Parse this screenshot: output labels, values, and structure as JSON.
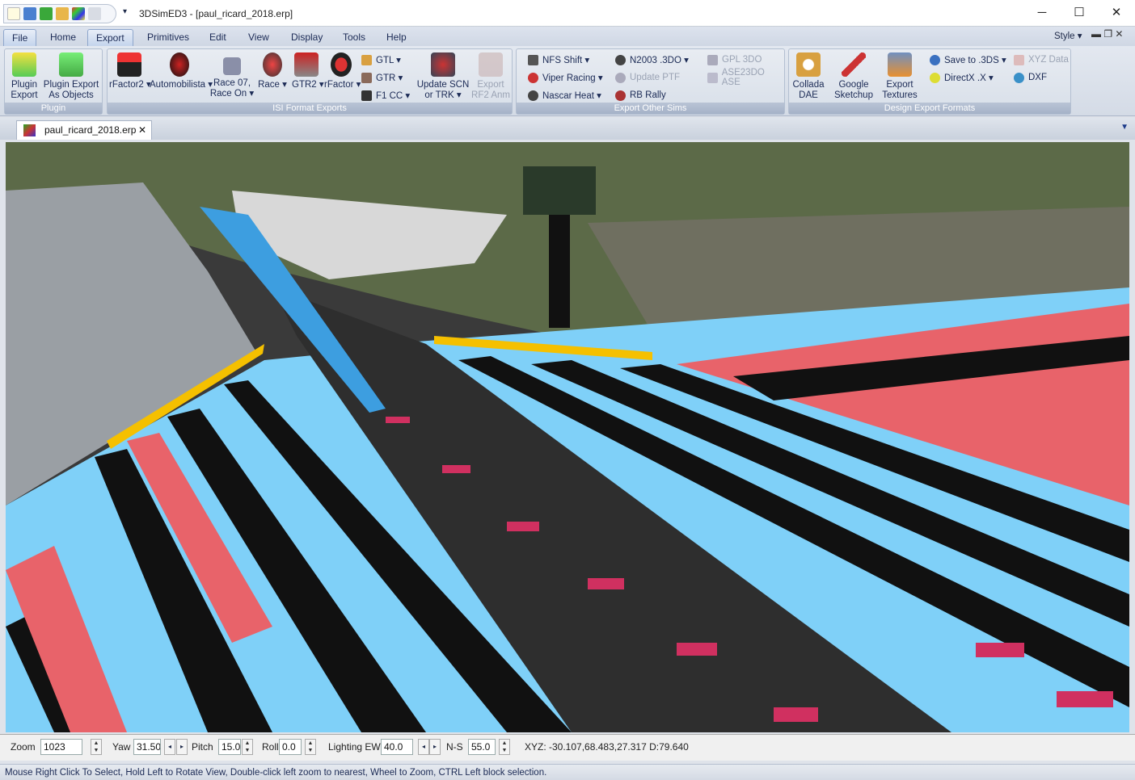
{
  "window": {
    "title": "3DSimED3 - [paul_ricard_2018.erp]",
    "minimize": "─",
    "maximize": "☐",
    "close": "✕"
  },
  "menu": {
    "tabs": [
      "File",
      "Home",
      "Export",
      "Primitives",
      "Edit",
      "View",
      "Display",
      "Tools",
      "Help"
    ],
    "active": "Export",
    "style": "Style ▾"
  },
  "ribbon": {
    "plugin": {
      "label": "Plugin",
      "buttons": [
        "Plugin\nExport",
        "Plugin Export\nAs Objects"
      ]
    },
    "isi": {
      "label": "ISI Format Exports",
      "buttons": [
        "rFactor2 ▾",
        "Automobilista ▾",
        "Race 07,\nRace On ▾",
        "Race ▾",
        "GTR2 ▾",
        "rFactor ▾"
      ],
      "small": [
        "GTL ▾",
        "GTR ▾",
        "F1 CC ▾"
      ],
      "buttons2": [
        "Update SCN\nor TRK ▾",
        "Export\nRF2 Anm"
      ]
    },
    "other": {
      "label": "Export Other Sims",
      "col1": [
        "NFS Shift ▾",
        "Viper Racing ▾",
        "Nascar Heat ▾"
      ],
      "col2": [
        "N2003 .3DO ▾",
        "Update PTF",
        "RB Rally"
      ],
      "col3": [
        "GPL 3DO",
        "ASE23DO ASE"
      ]
    },
    "design": {
      "label": "Design Export Formats",
      "buttons": [
        "Collada\nDAE",
        "Google\nSketchup",
        "Export\nTextures"
      ],
      "col1": [
        "Save to .3DS ▾",
        "DirectX .X ▾"
      ],
      "col2": [
        "XYZ Data",
        "DXF"
      ]
    }
  },
  "document_tab": {
    "name": "paul_ricard_2018.erp",
    "close": "✕"
  },
  "controls": {
    "zoom_label": "Zoom",
    "zoom": "1023",
    "yaw_label": "Yaw",
    "yaw": "31.50",
    "pitch_label": "Pitch",
    "pitch": "15.0",
    "roll_label": "Roll",
    "roll": "0.0",
    "lighting_label": "Lighting EW",
    "lighting": "40.0",
    "ns_label": "N-S",
    "ns": "55.0",
    "xyz": "XYZ: -30.107,68.483,27.317  D:79.640"
  },
  "status": "Mouse Right Click To Select, Hold Left to Rotate View, Double-click left  zoom to nearest, Wheel to Zoom, CTRL Left block selection.",
  "colors": {
    "kerb_blue": "#7fd0f8",
    "kerb_red": "#e8636a",
    "asphalt": "#2e2e2e",
    "ribbon_label": "#a9b5ca"
  }
}
